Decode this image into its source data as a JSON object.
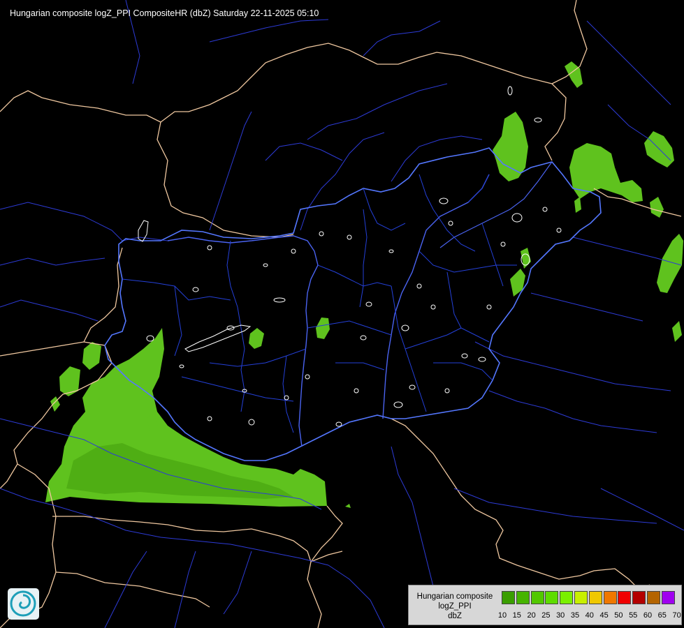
{
  "title": "Hungarian composite logZ_PPI CompositeHR (dbZ) Saturday 22-11-2025 05:10",
  "legend": {
    "name_lines": [
      "Hungarian composite",
      "logZ_PPI",
      "dbZ"
    ],
    "scale": [
      {
        "value": "10",
        "color": "#3a9e00"
      },
      {
        "value": "15",
        "color": "#46b400"
      },
      {
        "value": "20",
        "color": "#52c800"
      },
      {
        "value": "25",
        "color": "#5edc00"
      },
      {
        "value": "30",
        "color": "#7af000"
      },
      {
        "value": "35",
        "color": "#c8f000"
      },
      {
        "value": "40",
        "color": "#f0c800"
      },
      {
        "value": "45",
        "color": "#f07800"
      },
      {
        "value": "50",
        "color": "#f00000"
      },
      {
        "value": "55",
        "color": "#b40000"
      },
      {
        "value": "60",
        "color": "#b46400"
      },
      {
        "value": "65",
        "color": "#a000f0"
      },
      {
        "value": "70",
        "color": "#a0a0f0"
      }
    ]
  },
  "colors": {
    "background": "#000000",
    "country_border": "#f0c8a0",
    "hungary_border": "#4f6ef7",
    "river": "#2d3bd6",
    "county_border": "#1f38c8",
    "lake_outline": "#ffffff",
    "echo_light": "#6ccd2a",
    "echo_mid": "#5bb81c",
    "echo_dark": "#4aa510"
  },
  "icons": {
    "logo": "met-service-swirl-logo"
  }
}
